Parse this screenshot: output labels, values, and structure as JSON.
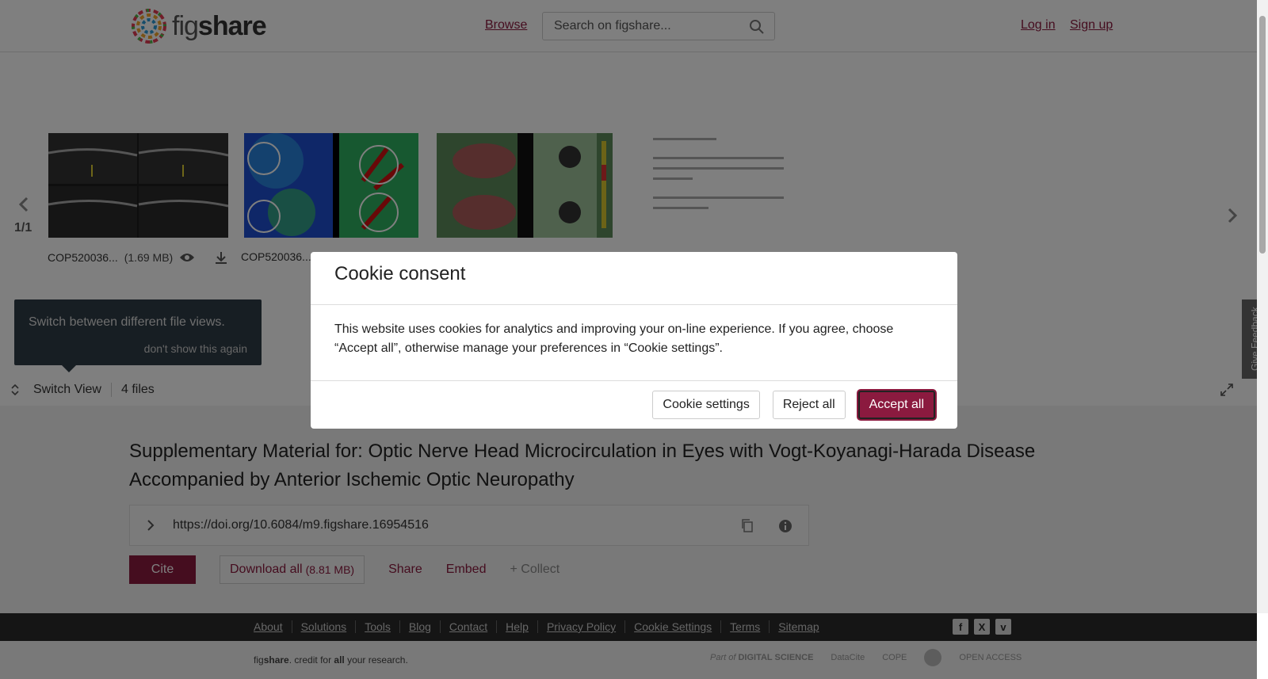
{
  "header": {
    "logo_text_fig": "fig",
    "logo_text_share": "share",
    "browse": "Browse",
    "search_placeholder": "Search on figshare...",
    "login": "Log in",
    "signup": "Sign up"
  },
  "viewer": {
    "pager": "1/1",
    "files": [
      {
        "name": "COP520036...",
        "size": "(1.69 MB)"
      },
      {
        "name": "COP520036...",
        "size": ""
      }
    ],
    "tip": {
      "text": "Switch between different file views.",
      "dismiss": "don't show this again"
    },
    "switch_view": "Switch View",
    "file_count": "4 files",
    "feedback": "Give Feedback"
  },
  "article": {
    "title": "Supplementary Material for: Optic Nerve Head Microcirculation in Eyes with Vogt-Koyanagi-Harada Disease Accompanied by Anterior Ischemic Optic Neuropathy",
    "doi": "https://doi.org/10.6084/m9.figshare.16954516",
    "cite": "Cite",
    "download_all": "Download all",
    "download_size": "(8.81 MB)",
    "share": "Share",
    "embed": "Embed",
    "collect": "+ Collect"
  },
  "footer": {
    "links": [
      "About",
      "Solutions",
      "Tools",
      "Blog",
      "Contact",
      "Help",
      "Privacy Policy",
      "Cookie Settings",
      "Terms",
      "Sitemap"
    ],
    "tagline_fig": "fig",
    "tagline_share": "share",
    "tagline_mid": ". credit for ",
    "tagline_all": "all",
    "tagline_end": " your research.",
    "partner_part_of": "Part of",
    "partner_digital_science": "DIGITAL SCIENCE",
    "partner_datacite": "DataCite",
    "partner_cope": "COPE",
    "partner_open_access": "OPEN ACCESS"
  },
  "cookie": {
    "title": "Cookie consent",
    "body": "This website uses cookies for analytics and improving your on-line experience. If you agree, choose “Accept all”, otherwise manage your preferences in “Cookie settings”.",
    "settings": "Cookie settings",
    "reject": "Reject all",
    "accept": "Accept all"
  },
  "colors": {
    "brand": "#8b1a3f",
    "footer": "#2b2b2b"
  }
}
